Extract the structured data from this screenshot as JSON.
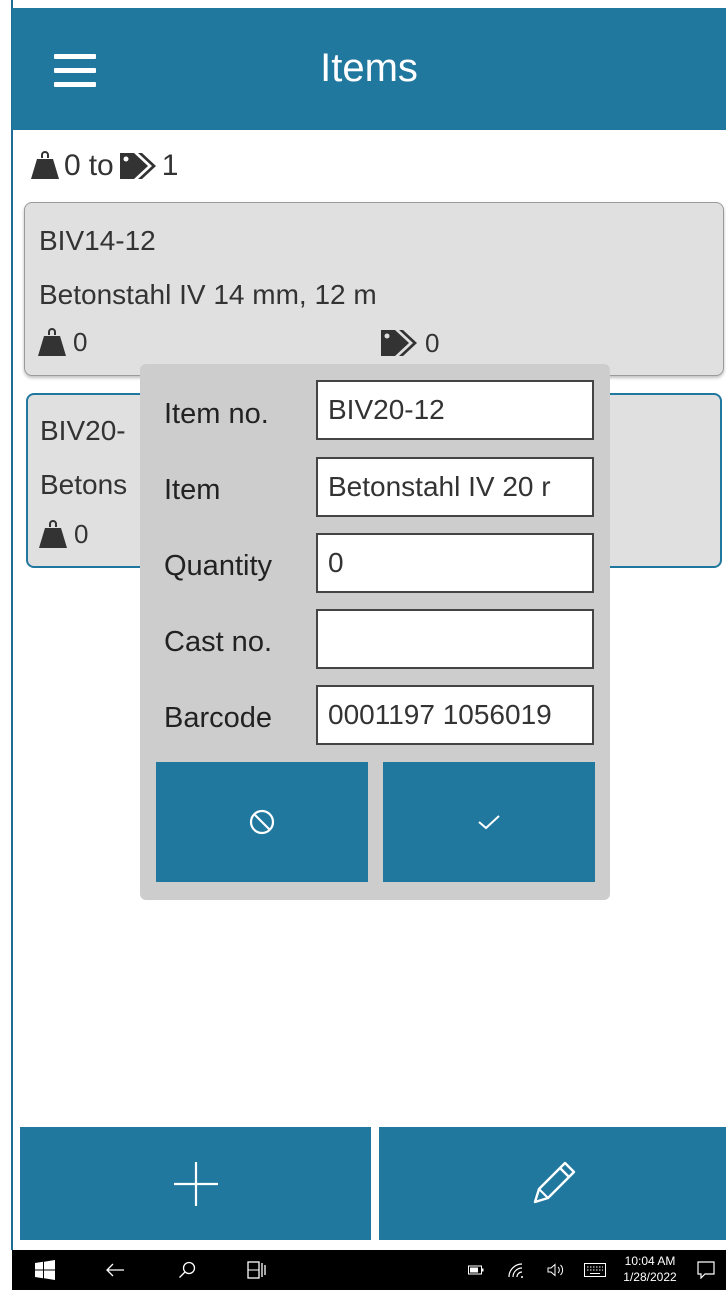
{
  "header": {
    "title": "Items",
    "menu_icon": "hamburger-icon"
  },
  "summary": {
    "from_count": "0",
    "to_word": "to",
    "to_count": "1",
    "weight_icon": "weight-icon",
    "tag_icon": "tags-icon"
  },
  "items": [
    {
      "item_no": "BIV14-12",
      "description": "Betonstahl IV 14 mm, 12 m",
      "weight": "0",
      "tags": "0"
    },
    {
      "item_no": "BIV20-",
      "description": "Betons",
      "weight": "0"
    }
  ],
  "dialog": {
    "fields": [
      {
        "label": "Item no.",
        "value": "BIV20-12"
      },
      {
        "label": "Item",
        "value": "Betonstahl IV 20 r"
      },
      {
        "label": "Quantity",
        "value": "0"
      },
      {
        "label": "Cast no.",
        "value": ""
      },
      {
        "label": "Barcode",
        "value": "0001197 1056019"
      }
    ],
    "cancel_icon": "cancel-icon",
    "confirm_icon": "checkmark-icon"
  },
  "bottom_bar": {
    "add_icon": "plus-icon",
    "edit_icon": "pencil-icon"
  },
  "taskbar": {
    "time": "10:04 AM",
    "date": "1/28/2022"
  },
  "colors": {
    "accent": "#21789f",
    "card_bg": "#e0e0e0",
    "dialog_bg": "#cdcdcd",
    "taskbar_bg": "#000000"
  }
}
